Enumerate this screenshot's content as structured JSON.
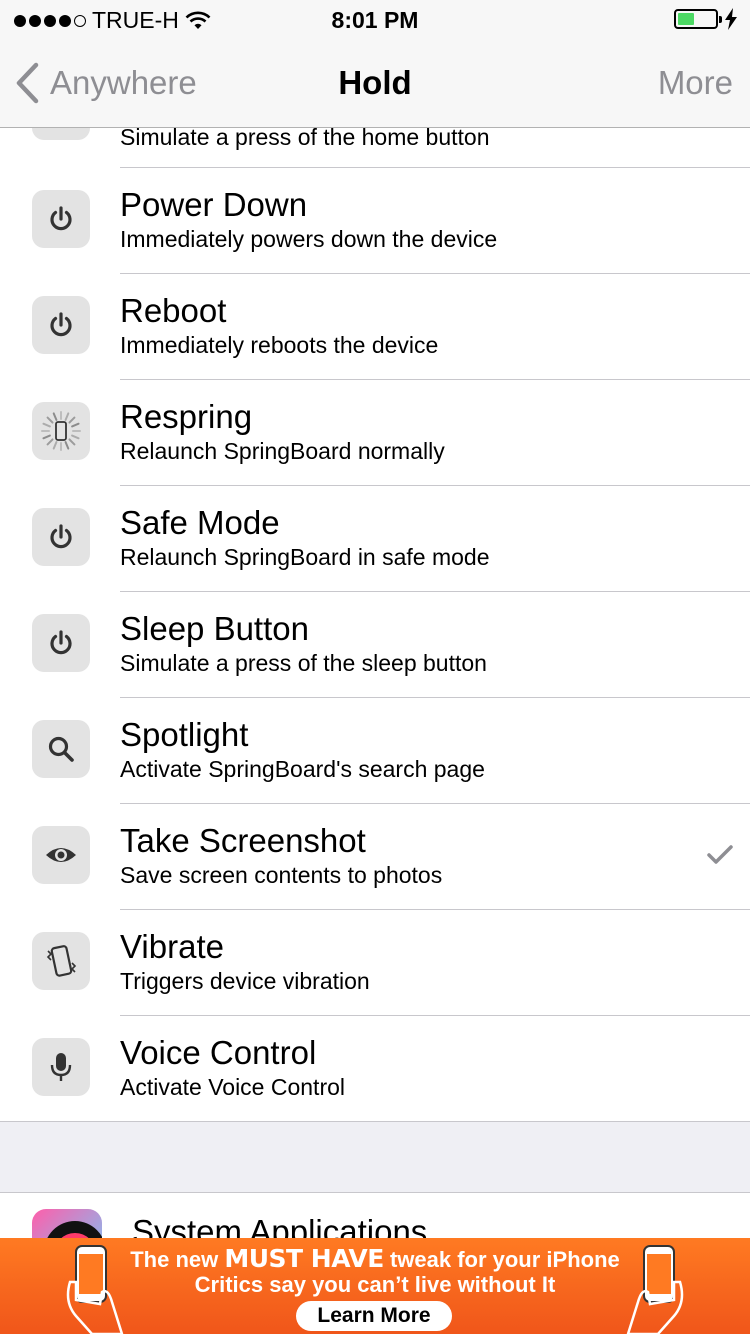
{
  "status_bar": {
    "carrier": "TRUE-H",
    "time": "8:01 PM",
    "battery_level": 0.45
  },
  "nav": {
    "back_label": "Anywhere",
    "title": "Hold",
    "more_label": "More"
  },
  "partial_row": {
    "subtitle": "Simulate a press of the home button",
    "icon": "home-icon"
  },
  "actions": [
    {
      "title": "Power Down",
      "subtitle": "Immediately powers down the device",
      "icon": "power-icon",
      "checked": false
    },
    {
      "title": "Reboot",
      "subtitle": "Immediately reboots the device",
      "icon": "power-icon",
      "checked": false
    },
    {
      "title": "Respring",
      "subtitle": "Relaunch SpringBoard normally",
      "icon": "respring-spinner-icon",
      "checked": false
    },
    {
      "title": "Safe Mode",
      "subtitle": "Relaunch SpringBoard in safe mode",
      "icon": "power-icon",
      "checked": false
    },
    {
      "title": "Sleep Button",
      "subtitle": "Simulate a press of the sleep button",
      "icon": "power-icon",
      "checked": false
    },
    {
      "title": "Spotlight",
      "subtitle": "Activate SpringBoard's search page",
      "icon": "search-icon",
      "checked": false
    },
    {
      "title": "Take Screenshot",
      "subtitle": "Save screen contents to photos",
      "icon": "eye-icon",
      "checked": true
    },
    {
      "title": "Vibrate",
      "subtitle": "Triggers device vibration",
      "icon": "vibrate-phone-icon",
      "checked": false
    },
    {
      "title": "Voice Control",
      "subtitle": "Activate Voice Control",
      "icon": "microphone-icon",
      "checked": false
    }
  ],
  "system_apps": {
    "title": "System Applications"
  },
  "ad": {
    "line1_pre": "The new",
    "line1_em": "MUST HAVE",
    "line1_post": "tweak for your iPhone",
    "line2": "Critics say you can’t live without It",
    "button": "Learn More"
  },
  "colors": {
    "accent_gray": "#8e8e93",
    "battery": "#4cd964",
    "ad_orange": "#f0561a"
  }
}
